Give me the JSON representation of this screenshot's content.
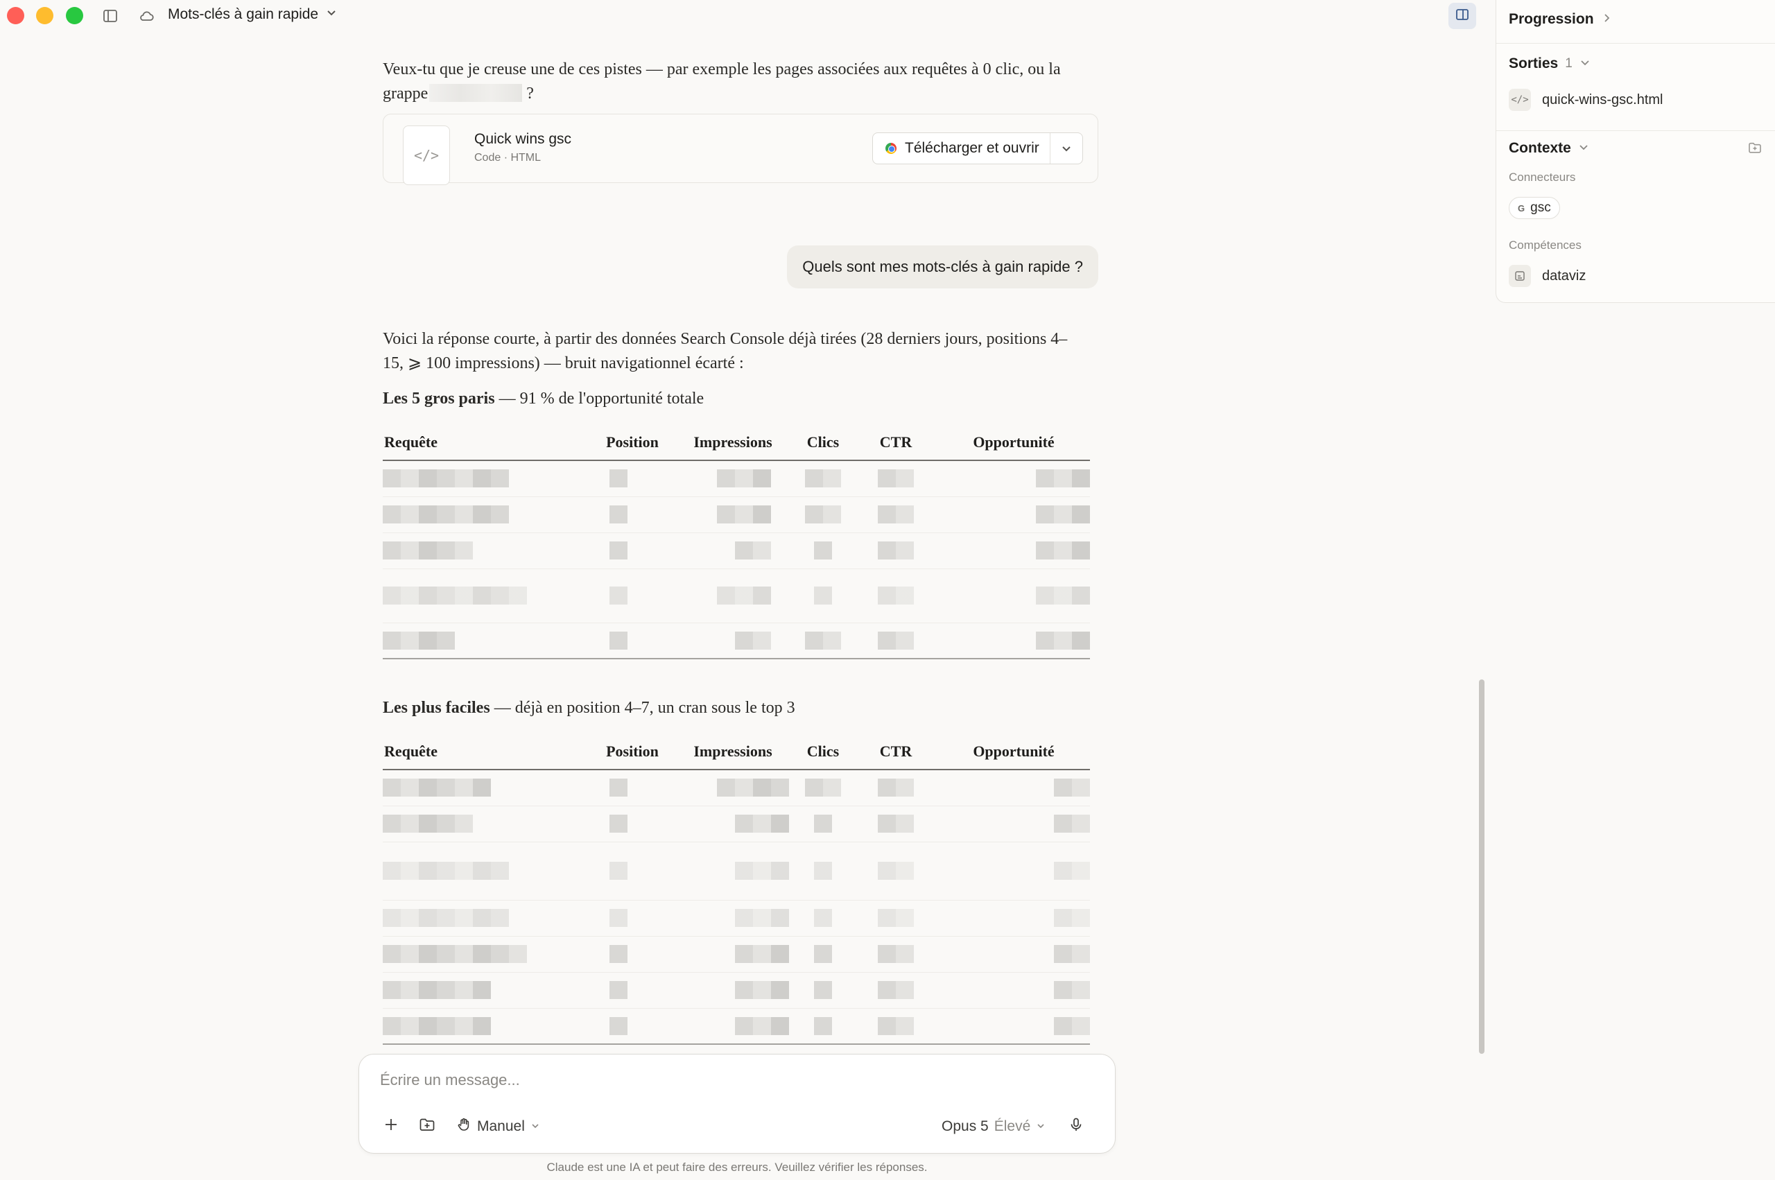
{
  "window": {
    "title": "Mots-clés à gain rapide",
    "sidebar_icon": "sidebar-icon",
    "cloud_icon": "cloud-icon"
  },
  "conversation": {
    "assistant_intro": {
      "text": "Veux-tu que je creuse une de ces pistes — par exemple les pages associées aux requêtes à 0 clic, ou la grappe",
      "suffix": "?"
    },
    "artifact": {
      "name": "Quick wins gsc",
      "meta": "Code · HTML",
      "thumb_glyph": "</>",
      "download_label": "Télécharger et ouvrir"
    },
    "user_message": "Quels sont mes mots-clés à gain rapide ?",
    "answer_intro": "Voici la réponse courte, à partir des données Search Console déjà tirées (28 derniers jours, positions 4–15, ⩾ 100 impressions) — bruit navigationnel écarté :",
    "section1": {
      "title_bold": "Les 5 gros paris",
      "title_rest": " — 91 % de l'opportunité totale",
      "headers": [
        "Requête",
        "Position",
        "Impressions",
        "Clics",
        "CTR",
        "Opportunité"
      ],
      "row_count": 5
    },
    "section2": {
      "title_bold": "Les plus faciles",
      "title_rest": " — déjà en position 4–7, un cran sous le top 3",
      "headers": [
        "Requête",
        "Position",
        "Impressions",
        "Clics",
        "CTR",
        "Opportunité"
      ],
      "row_count": 7
    }
  },
  "composer": {
    "placeholder": "Écrire un message...",
    "mode_label": "Manuel",
    "model_name": "Opus 5",
    "effort_label": "Élevé",
    "disclaimer": "Claude est une IA et peut faire des erreurs. Veuillez vérifier les réponses."
  },
  "panel": {
    "progress_label": "Progression",
    "outputs_label": "Sorties",
    "outputs_count": "1",
    "output_file": "quick-wins-gsc.html",
    "context_label": "Contexte",
    "connectors_label": "Connecteurs",
    "connector_badge": "G",
    "connector_name": "gsc",
    "skills_label": "Compétences",
    "skill_name": "dataviz"
  }
}
